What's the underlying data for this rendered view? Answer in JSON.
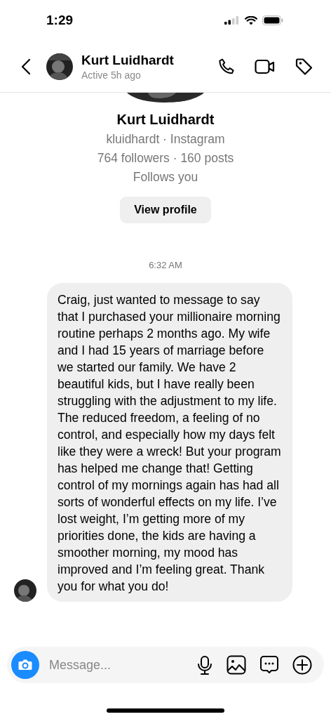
{
  "status_bar": {
    "time": "1:29"
  },
  "header": {
    "name": "Kurt Luidhardt",
    "status": "Active 5h ago"
  },
  "profile": {
    "name": "Kurt Luidhardt",
    "handle": "kluidhardt · Instagram",
    "stats": "764 followers · 160 posts",
    "relation": "Follows you",
    "button": "View profile"
  },
  "messages": [
    {
      "kind": "timestamp",
      "text": "6:32 AM"
    },
    {
      "kind": "incoming",
      "text": "Craig, just wanted to message to say that I purchased your millionaire morning routine perhaps 2 months ago.  My wife and I had 15 years of marriage before we started our family. We have 2 beautiful kids, but I have really been struggling with the adjustment to my life.  The reduced freedom, a feeling of no control, and especially how my days felt like they were a wreck! But your program has helped me change that! Getting control of my mornings again has had all sorts of wonderful effects on my life. I’ve lost weight, I’m getting more of my priorities done, the kids are having a smoother morning, my mood has improved and I’m feeling great. Thank you for what you do!"
    }
  ],
  "composer": {
    "placeholder": "Message..."
  }
}
